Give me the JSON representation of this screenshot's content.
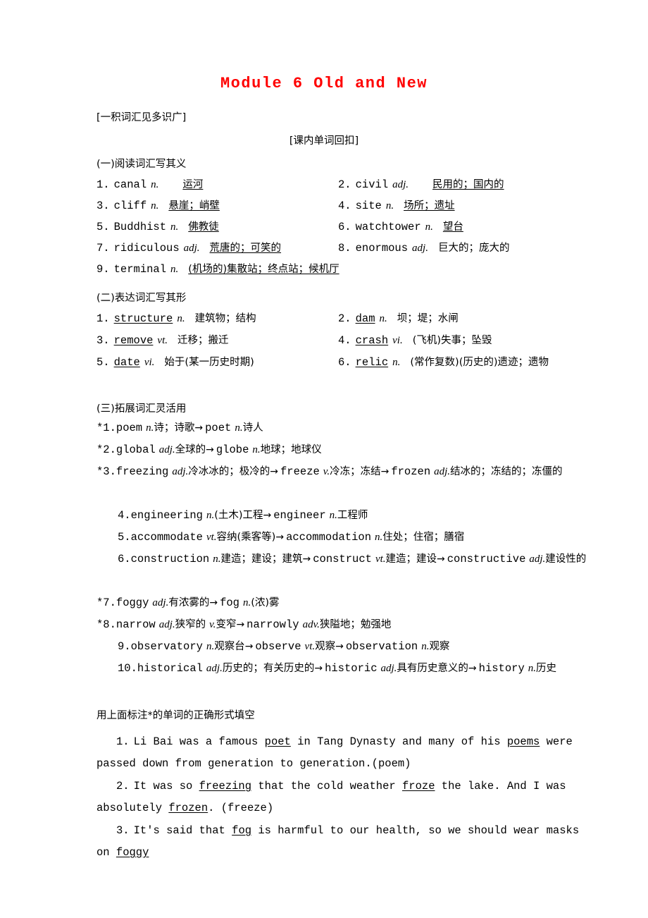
{
  "document": {
    "title": "Module 6 Old and New",
    "title_color": "#ff0000",
    "bracket_heading": "[一积词汇见多识广]",
    "centered_heading": "[课内单词回扣]"
  },
  "section_one": {
    "heading": "(一)阅读词汇写其义",
    "items": [
      {
        "num": "1.",
        "word": "canal",
        "pos": "n.",
        "answer": "运河",
        "underlined": true,
        "gap": "large"
      },
      {
        "num": "2.",
        "word": "civil",
        "pos": "adj.",
        "answer": "民用的；国内的",
        "underlined": true,
        "gap": "large"
      },
      {
        "num": "3.",
        "word": "cliff",
        "pos": "n.",
        "answer": "悬崖；峭壁",
        "underlined": true,
        "gap": "small"
      },
      {
        "num": "4.",
        "word": "site",
        "pos": "n.",
        "answer": "场所；遗址",
        "underlined": true,
        "gap": "small"
      },
      {
        "num": "5.",
        "word": "Buddhist",
        "pos": "n.",
        "answer": "佛教徒",
        "underlined": true,
        "gap": "small"
      },
      {
        "num": "6.",
        "word": "watchtower",
        "pos": "n.",
        "answer": "望台",
        "underlined": true,
        "gap": "small"
      },
      {
        "num": "7.",
        "word": "ridiculous",
        "pos": "adj.",
        "answer": "荒唐的；可笑的",
        "underlined": true,
        "gap": "small"
      },
      {
        "num": "8.",
        "word": "enormous",
        "pos": "adj.",
        "answer": "巨大的；庞大的",
        "underlined": false,
        "gap": "small"
      },
      {
        "num": "9.",
        "word": "terminal",
        "pos": "n.",
        "answer": "(机场的)集散站；终点站；候机厅",
        "underlined": true,
        "gap": "small"
      }
    ]
  },
  "section_two": {
    "heading": "(二)表达词汇写其形",
    "items": [
      {
        "num": "1.",
        "word": "structure",
        "pos": "n.",
        "answer": "建筑物；结构"
      },
      {
        "num": "2.",
        "word": "dam",
        "pos": "n.",
        "answer": "坝；堤；水闸"
      },
      {
        "num": "3.",
        "word": "remove",
        "pos": "vt.",
        "answer": "迁移；搬迁"
      },
      {
        "num": "4.",
        "word": "crash",
        "pos": "vi.",
        "answer": "(飞机)失事；坠毁"
      },
      {
        "num": "5.",
        "word": "date",
        "pos": "vi.",
        "answer": "始于(某一历史时期)"
      },
      {
        "num": "6.",
        "word": "relic",
        "pos": "n.",
        "answer": "(常作复数)(历史的)遗迹；遗物"
      }
    ]
  },
  "section_three": {
    "heading": "(三)拓展词汇灵活用",
    "items": [
      {
        "label": "*1.",
        "indent": false,
        "parts": [
          {
            "t": "word",
            "v": "poem"
          },
          {
            "t": "pos",
            "v": "n."
          },
          {
            "t": "cn",
            "v": "诗；诗歌"
          },
          {
            "t": "arrow"
          },
          {
            "t": "word",
            "v": "poet"
          },
          {
            "t": "pos",
            "v": "n."
          },
          {
            "t": "cn",
            "v": "诗人"
          }
        ]
      },
      {
        "label": "*2.",
        "indent": false,
        "parts": [
          {
            "t": "word",
            "v": "global"
          },
          {
            "t": "pos",
            "v": "adj."
          },
          {
            "t": "cn",
            "v": "全球的"
          },
          {
            "t": "arrow"
          },
          {
            "t": "word",
            "v": "globe"
          },
          {
            "t": "pos",
            "v": "n."
          },
          {
            "t": "cn",
            "v": "地球；地球仪"
          }
        ]
      },
      {
        "label": "*3.",
        "indent": false,
        "parts": [
          {
            "t": "word",
            "v": "freezing"
          },
          {
            "t": "pos",
            "v": "adj."
          },
          {
            "t": "cn",
            "v": "冷冰冰的；极冷的"
          },
          {
            "t": "arrow"
          },
          {
            "t": "word",
            "v": "freeze"
          },
          {
            "t": "pos",
            "v": "v."
          },
          {
            "t": "cn",
            "v": "冷冻；冻结"
          },
          {
            "t": "arrow"
          },
          {
            "t": "word",
            "v": "frozen"
          },
          {
            "t": "pos",
            "v": "adj."
          },
          {
            "t": "cn",
            "v": "结冰的；冻结的；冻僵的"
          }
        ]
      },
      {
        "label": "4.",
        "indent": true,
        "parts": [
          {
            "t": "word",
            "v": "engineering"
          },
          {
            "t": "pos",
            "v": "n."
          },
          {
            "t": "cn",
            "v": "(土木)工程"
          },
          {
            "t": "arrow"
          },
          {
            "t": "word",
            "v": "engineer"
          },
          {
            "t": "pos",
            "v": "n."
          },
          {
            "t": "cn",
            "v": "工程师"
          }
        ]
      },
      {
        "label": "5.",
        "indent": true,
        "parts": [
          {
            "t": "word",
            "v": "accommodate"
          },
          {
            "t": "pos",
            "v": "vt."
          },
          {
            "t": "cn",
            "v": "容纳(乘客等)"
          },
          {
            "t": "arrow"
          },
          {
            "t": "word",
            "v": "accommodation"
          },
          {
            "t": "pos",
            "v": "n."
          },
          {
            "t": "cn",
            "v": "住处；住宿；膳宿"
          }
        ]
      },
      {
        "label": "6.",
        "indent": true,
        "parts": [
          {
            "t": "word",
            "v": "construction"
          },
          {
            "t": "pos",
            "v": "n."
          },
          {
            "t": "cn",
            "v": "建造；建设；建筑"
          },
          {
            "t": "arrow"
          },
          {
            "t": "word",
            "v": "construct"
          },
          {
            "t": "pos",
            "v": "vt."
          },
          {
            "t": "cn",
            "v": "建造；建设"
          },
          {
            "t": "arrow"
          },
          {
            "t": "word",
            "v": "constructive"
          },
          {
            "t": "pos",
            "v": "adj."
          },
          {
            "t": "cn",
            "v": "建设性的"
          }
        ]
      },
      {
        "label": "*7.",
        "indent": false,
        "parts": [
          {
            "t": "word",
            "v": "foggy"
          },
          {
            "t": "pos",
            "v": "adj."
          },
          {
            "t": "cn",
            "v": "有浓雾的"
          },
          {
            "t": "arrow"
          },
          {
            "t": "word",
            "v": "fog"
          },
          {
            "t": "pos",
            "v": "n."
          },
          {
            "t": "cn",
            "v": "(浓)雾"
          }
        ]
      },
      {
        "label": "*8.",
        "indent": false,
        "parts": [
          {
            "t": "word",
            "v": "narrow"
          },
          {
            "t": "pos",
            "v": "adj."
          },
          {
            "t": "cn",
            "v": "狭窄的"
          },
          {
            "t": "pos",
            "v": "v."
          },
          {
            "t": "cn",
            "v": "变窄"
          },
          {
            "t": "arrow"
          },
          {
            "t": "word",
            "v": "narrowly"
          },
          {
            "t": "pos",
            "v": "adv."
          },
          {
            "t": "cn",
            "v": "狭隘地；勉强地"
          }
        ]
      },
      {
        "label": "9.",
        "indent": true,
        "parts": [
          {
            "t": "word",
            "v": "observatory"
          },
          {
            "t": "pos",
            "v": "n."
          },
          {
            "t": "cn",
            "v": "观察台"
          },
          {
            "t": "arrow"
          },
          {
            "t": "word",
            "v": "observe"
          },
          {
            "t": "pos",
            "v": "vt."
          },
          {
            "t": "cn",
            "v": "观察"
          },
          {
            "t": "arrow"
          },
          {
            "t": "word",
            "v": "observation"
          },
          {
            "t": "pos",
            "v": "n."
          },
          {
            "t": "cn",
            "v": "观察"
          }
        ]
      },
      {
        "label": "10.",
        "indent": true,
        "parts": [
          {
            "t": "word",
            "v": "historical"
          },
          {
            "t": "pos",
            "v": "adj."
          },
          {
            "t": "cn",
            "v": "历史的；有关历史的"
          },
          {
            "t": "arrow"
          },
          {
            "t": "word",
            "v": "historic"
          },
          {
            "t": "pos",
            "v": "adj."
          },
          {
            "t": "cn",
            "v": "具有历史意义的"
          },
          {
            "t": "arrow"
          },
          {
            "t": "word",
            "v": "history"
          },
          {
            "t": "pos",
            "v": "n."
          },
          {
            "t": "cn",
            "v": "历史"
          }
        ]
      }
    ]
  },
  "exercise": {
    "instruction": "用上面标注*的单词的正确形式填空",
    "sentences": [
      {
        "num": "1.",
        "segments": [
          {
            "t": "p",
            "v": "Li Bai was a famous "
          },
          {
            "t": "u",
            "v": "poet"
          },
          {
            "t": "p",
            "v": " in Tang Dynasty and many of his "
          },
          {
            "t": "u",
            "v": "poems"
          },
          {
            "t": "p",
            "v": " were passed down from generation to generation.(poem)"
          }
        ]
      },
      {
        "num": "2.",
        "segments": [
          {
            "t": "p",
            "v": "It was so "
          },
          {
            "t": "u",
            "v": "freezing"
          },
          {
            "t": "p",
            "v": " that the cold weather "
          },
          {
            "t": "u",
            "v": "froze"
          },
          {
            "t": "p",
            "v": " the lake. And I was absolutely "
          },
          {
            "t": "u",
            "v": "frozen"
          },
          {
            "t": "p",
            "v": ". (freeze)"
          }
        ]
      },
      {
        "num": "3.",
        "segments": [
          {
            "t": "p",
            "v": "It's said that "
          },
          {
            "t": "u",
            "v": "fog"
          },
          {
            "t": "p",
            "v": " is harmful to our health, so we should wear masks on "
          },
          {
            "t": "u",
            "v": "foggy"
          }
        ]
      }
    ]
  }
}
